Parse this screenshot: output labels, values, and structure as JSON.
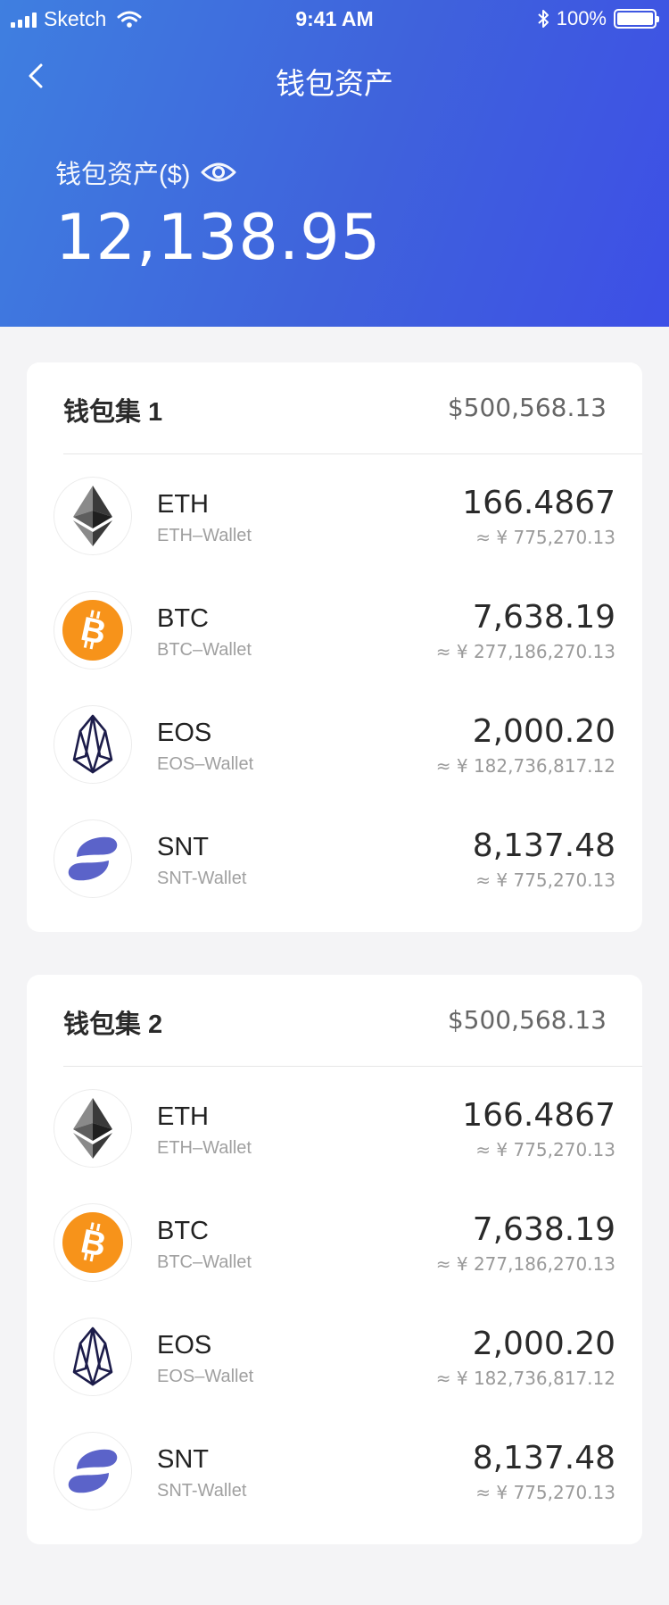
{
  "status_bar": {
    "carrier": "Sketch",
    "time": "9:41 AM",
    "battery": "100%"
  },
  "nav": {
    "title": "钱包资产",
    "back_icon": "chevron-left-icon"
  },
  "summary": {
    "label": "钱包资产($)",
    "eye_icon": "eye-icon",
    "total": "12,138.95"
  },
  "wallet_sets": [
    {
      "title": "钱包集 1",
      "total": "$500,568.13",
      "assets": [
        {
          "symbol": "ETH",
          "wallet": "ETH–Wallet",
          "amount": "166.4867",
          "fiat": "≈ ¥ 775,270.13",
          "icon": "eth-icon"
        },
        {
          "symbol": "BTC",
          "wallet": "BTC–Wallet",
          "amount": "7,638.19",
          "fiat": "≈ ¥ 277,186,270.13",
          "icon": "btc-icon"
        },
        {
          "symbol": "EOS",
          "wallet": "EOS–Wallet",
          "amount": "2,000.20",
          "fiat": "≈ ¥ 182,736,817.12",
          "icon": "eos-icon"
        },
        {
          "symbol": "SNT",
          "wallet": "SNT-Wallet",
          "amount": "8,137.48",
          "fiat": "≈ ¥ 775,270.13",
          "icon": "snt-icon"
        }
      ]
    },
    {
      "title": "钱包集 2",
      "total": "$500,568.13",
      "assets": [
        {
          "symbol": "ETH",
          "wallet": "ETH–Wallet",
          "amount": "166.4867",
          "fiat": "≈ ¥ 775,270.13",
          "icon": "eth-icon"
        },
        {
          "symbol": "BTC",
          "wallet": "BTC–Wallet",
          "amount": "7,638.19",
          "fiat": "≈ ¥ 277,186,270.13",
          "icon": "btc-icon"
        },
        {
          "symbol": "EOS",
          "wallet": "EOS–Wallet",
          "amount": "2,000.20",
          "fiat": "≈ ¥ 182,736,817.12",
          "icon": "eos-icon"
        },
        {
          "symbol": "SNT",
          "wallet": "SNT-Wallet",
          "amount": "8,137.48",
          "fiat": "≈ ¥ 775,270.13",
          "icon": "snt-icon"
        }
      ]
    }
  ],
  "colors": {
    "header_start": "#3f7fe0",
    "header_end": "#3d4fe6",
    "btc_orange": "#f7931a",
    "eos_navy": "#1c1c4a",
    "snt_purple": "#5b63c9"
  }
}
